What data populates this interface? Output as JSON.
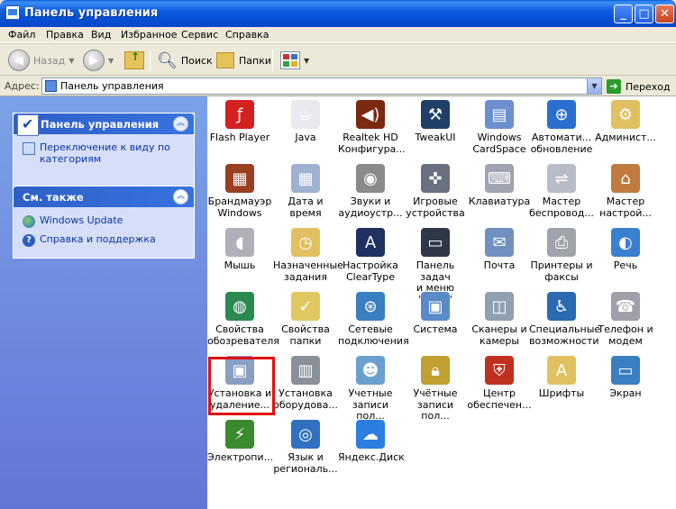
{
  "window": {
    "title": "Панель управления"
  },
  "menu": {
    "items": [
      "Файл",
      "Правка",
      "Вид",
      "Избранное",
      "Сервис",
      "Справка"
    ]
  },
  "toolbar": {
    "back_label": "Назад",
    "search_label": "Поиск",
    "folders_label": "Папки"
  },
  "address": {
    "label": "Адрес:",
    "value": "Панель управления",
    "go_label": "Переход"
  },
  "sidebar": {
    "panel_title": "Панель управления",
    "panel_link": "Переключение к виду по категориям",
    "see_also_title": "См. также",
    "see_also_links": [
      "Windows Update",
      "Справка и поддержка"
    ]
  },
  "items": [
    {
      "label": "Flash Player",
      "icon": "flash-icon",
      "color": "#d42020"
    },
    {
      "label": "Java",
      "icon": "java-icon",
      "color": "#e8eaf0"
    },
    {
      "label": "Realtek HD\nКонфигура...",
      "icon": "speaker-icon",
      "color": "#7a2a10"
    },
    {
      "label": "TweakUI",
      "icon": "tweakui-icon",
      "color": "#20406a"
    },
    {
      "label": "Windows\nCardSpace",
      "icon": "cardspace-icon",
      "color": "#6c8fd0"
    },
    {
      "label": "Автомати...\nобновление",
      "icon": "globe-update-icon",
      "color": "#2a6fd0"
    },
    {
      "label": "Админист...",
      "icon": "admin-folder-icon",
      "color": "#e0c060"
    },
    {
      "label": "Брандмауэр\nWindows",
      "icon": "firewall-icon",
      "color": "#9a4020"
    },
    {
      "label": "Дата и время",
      "icon": "calendar-icon",
      "color": "#9fb0d0"
    },
    {
      "label": "Звуки и\nаудиоустр...",
      "icon": "sound-icon",
      "color": "#8a8a8a"
    },
    {
      "label": "Игровые\nустройства",
      "icon": "gamepad-icon",
      "color": "#6a7080"
    },
    {
      "label": "Клавиатура",
      "icon": "keyboard-icon",
      "color": "#a0a4b0"
    },
    {
      "label": "Мастер\nбеспровод...",
      "icon": "wireless-icon",
      "color": "#b8bcc6"
    },
    {
      "label": "Мастер\nнастрой...",
      "icon": "home-network-icon",
      "color": "#c07a40"
    },
    {
      "label": "Мышь",
      "icon": "mouse-icon",
      "color": "#b0b0b8"
    },
    {
      "label": "Назначенные\nзадания",
      "icon": "tasks-folder-icon",
      "color": "#e0c060"
    },
    {
      "label": "Настройка\nClearType",
      "icon": "cleartype-icon",
      "color": "#203060"
    },
    {
      "label": "Панель задач\nи меню \"Пуск\"",
      "icon": "taskbar-icon",
      "color": "#303848"
    },
    {
      "label": "Почта",
      "icon": "mail-icon",
      "color": "#7090c0"
    },
    {
      "label": "Принтеры и\nфаксы",
      "icon": "printer-icon",
      "color": "#a0a4aa"
    },
    {
      "label": "Речь",
      "icon": "speech-icon",
      "color": "#3a80d0"
    },
    {
      "label": "Свойства\nобозревателя",
      "icon": "internet-options-icon",
      "color": "#2a8a50"
    },
    {
      "label": "Свойства\nпапки",
      "icon": "folder-options-icon",
      "color": "#e0c860"
    },
    {
      "label": "Сетевые\nподключения",
      "icon": "network-icon",
      "color": "#3a80c0"
    },
    {
      "label": "Система",
      "icon": "system-icon",
      "color": "#5a8ac8"
    },
    {
      "label": "Сканеры и\nкамеры",
      "icon": "scanner-icon",
      "color": "#90a0b0"
    },
    {
      "label": "Специальные\nвозможности",
      "icon": "accessibility-icon",
      "color": "#2a6ab0"
    },
    {
      "label": "Телефон и\nмодем",
      "icon": "phone-icon",
      "color": "#a0a0a8"
    },
    {
      "label": "Установка и\nудаление...",
      "icon": "add-remove-icon",
      "color": "#8aa0c0"
    },
    {
      "label": "Установка\nоборудова...",
      "icon": "hardware-icon",
      "color": "#8a9098"
    },
    {
      "label": "Учетные\nзаписи пол...",
      "icon": "user-accounts-icon",
      "color": "#6aa0d0"
    },
    {
      "label": "Учётные\nзаписи пол...",
      "icon": "lock-icon",
      "color": "#c0a030"
    },
    {
      "label": "Центр\nобеспечен...",
      "icon": "security-shield-icon",
      "color": "#c03020"
    },
    {
      "label": "Шрифты",
      "icon": "fonts-folder-icon",
      "color": "#e0c060"
    },
    {
      "label": "Экран",
      "icon": "display-icon",
      "color": "#3a80c0"
    },
    {
      "label": "Электропи...",
      "icon": "power-icon",
      "color": "#3a8a30"
    },
    {
      "label": "Язык и\nрегиональ...",
      "icon": "language-icon",
      "color": "#3070c0"
    },
    {
      "label": "Яндекс.Диск",
      "icon": "yandex-disk-icon",
      "color": "#2b7ee0"
    }
  ]
}
